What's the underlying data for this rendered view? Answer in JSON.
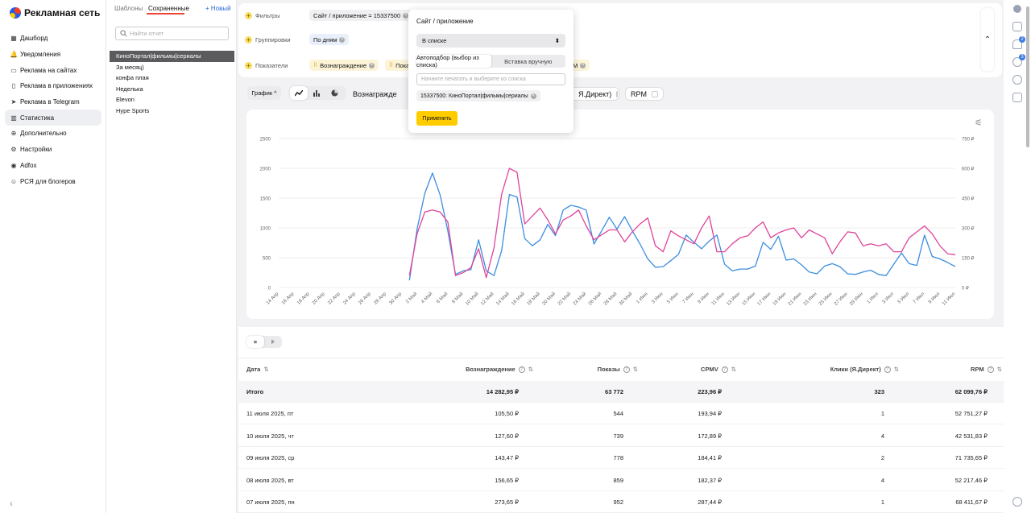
{
  "brand": {
    "name": "Рекламная сеть"
  },
  "nav": [
    {
      "label": "Дашборд",
      "icon": "dashboard-icon",
      "glyph": "▦"
    },
    {
      "label": "Уведомления",
      "icon": "bell-icon",
      "glyph": "🔔"
    },
    {
      "label": "Реклама на сайтах",
      "icon": "monitor-icon",
      "glyph": "▭"
    },
    {
      "label": "Реклама в приложениях",
      "icon": "phone-icon",
      "glyph": "▯"
    },
    {
      "label": "Реклама в Telegram",
      "icon": "telegram-icon",
      "glyph": "➤"
    },
    {
      "label": "Статистика",
      "icon": "chart-icon",
      "glyph": "▥",
      "active": true
    },
    {
      "label": "Дополнительно",
      "icon": "plus-circle-icon",
      "glyph": "⊕"
    },
    {
      "label": "Настройки",
      "icon": "wrench-icon",
      "glyph": "⚙"
    },
    {
      "label": "Adfox",
      "icon": "adfox-icon",
      "glyph": "◉"
    },
    {
      "label": "РСЯ для блогеров",
      "icon": "blogger-icon",
      "glyph": "☺"
    }
  ],
  "panel": {
    "tab_templates": "Шаблоны",
    "tab_saved": "Сохраненные",
    "new_label": "+ Новый",
    "search_placeholder": "Найти отчет",
    "reports": [
      "КиноПортал|фильмы|сериалы",
      "За месяц)",
      "конфа плая",
      "Неделька",
      "Elevon",
      "Hype Sports"
    ]
  },
  "filters": {
    "filters_label": "Фильтры",
    "filter_chip": "Сайт / приложение = 15337500",
    "groupings_label": "Группировки",
    "grouping_chip": "По дням",
    "indicators_label": "Показатели",
    "indicator_chips": [
      "Вознаграждение",
      "Пока",
      "М"
    ]
  },
  "toolbar": {
    "view_label": "График",
    "metrics": [
      "Вознагражде",
      "Я.Директ)",
      "RPM"
    ]
  },
  "popup": {
    "title": "Сайт / приложение",
    "select_value": "В списке",
    "tab_auto": "Автоподбор (выбор из списка)",
    "tab_manual": "Вставка вручную",
    "input_placeholder": "Начните печатать и выберите из списка",
    "selected_chip": "15337500: КиноПортал|фильмы|сериалы",
    "apply_label": "Применить"
  },
  "chart_data": {
    "type": "line",
    "x": [
      "14 Апр",
      "16 Апр",
      "18 Апр",
      "20 Апр",
      "22 Апр",
      "24 Апр",
      "26 Апр",
      "28 Апр",
      "30 Апр",
      "2 Май",
      "4 Май",
      "6 Май",
      "8 Май",
      "10 Май",
      "12 Май",
      "14 Май",
      "16 Май",
      "18 Май",
      "20 Май",
      "22 Май",
      "24 Май",
      "26 Май",
      "28 Май",
      "30 Май",
      "1 Июн",
      "3 Июн",
      "5 Июн",
      "7 Июн",
      "9 Июн",
      "11 Июн",
      "13 Июн",
      "15 Июн",
      "17 Июн",
      "19 Июн",
      "21 Июн",
      "23 Июн",
      "25 Июн",
      "27 Июн",
      "29 Июн",
      "1 Июл",
      "3 Июл",
      "5 Июл",
      "7 Июл",
      "9 Июл",
      "11 Июл"
    ],
    "left_axis": {
      "ticks": [
        "0",
        "500",
        "1000",
        "1500",
        "2000",
        "2500"
      ],
      "ylim": [
        0,
        2500
      ]
    },
    "right_axis": {
      "ticks": [
        "0 ₽",
        "150 ₽",
        "300 ₽",
        "450 ₽",
        "600 ₽",
        "750 ₽"
      ],
      "ylim": [
        0,
        750
      ]
    },
    "series": [
      {
        "color": "#3b8ee0",
        "axis": "left",
        "start_index": 17,
        "values": [
          120,
          980,
          1580,
          1920,
          1550,
          950,
          220,
          280,
          300,
          800,
          280,
          200,
          620,
          1560,
          1520,
          820,
          700,
          800,
          1060,
          870,
          1300,
          1380,
          1350,
          1300,
          730,
          950,
          1180,
          980,
          1190,
          950,
          730,
          480,
          340,
          350,
          450,
          560,
          880,
          760,
          650,
          780,
          880,
          390,
          280,
          310,
          310,
          360,
          760,
          640,
          860,
          460,
          480,
          380,
          260,
          230,
          360,
          400,
          350,
          230,
          220,
          260,
          290,
          220,
          200,
          390,
          580,
          400,
          370,
          880,
          520,
          480,
          420,
          350
        ]
      },
      {
        "color": "#e0439b",
        "axis": "right",
        "start_index": 17,
        "values": [
          60,
          270,
          380,
          390,
          380,
          330,
          60,
          75,
          100,
          195,
          50,
          200,
          470,
          600,
          580,
          320,
          360,
          400,
          340,
          270,
          340,
          360,
          390,
          310,
          240,
          265,
          290,
          290,
          230,
          280,
          320,
          350,
          210,
          180,
          285,
          260,
          240,
          220,
          300,
          360,
          180,
          180,
          220,
          250,
          260,
          300,
          330,
          250,
          275,
          290,
          300,
          250,
          290,
          270,
          250,
          170,
          230,
          280,
          275,
          210,
          220,
          210,
          220,
          180,
          180,
          250,
          280,
          310,
          270,
          210,
          170,
          165
        ]
      }
    ]
  },
  "table": {
    "headers": [
      "Дата",
      "Вознаграждение",
      "Показы",
      "CPMV",
      "Клики (Я.Директ)",
      "RPM"
    ],
    "total": [
      "Итого",
      "14 282,95 ₽",
      "63 772",
      "223,96 ₽",
      "323",
      "62 099,76 ₽"
    ],
    "rows": [
      [
        "11 июля 2025, пт",
        "105,50 ₽",
        "544",
        "193,94 ₽",
        "1",
        "52 751,27 ₽"
      ],
      [
        "10 июля 2025, чт",
        "127,60 ₽",
        "739",
        "172,89 ₽",
        "4",
        "42 531,83 ₽"
      ],
      [
        "09 июля 2025, ср",
        "143,47 ₽",
        "778",
        "184,41 ₽",
        "2",
        "71 735,65 ₽"
      ],
      [
        "08 июля 2025, вт",
        "156,65 ₽",
        "859",
        "182,37 ₽",
        "4",
        "52 217,46 ₽"
      ],
      [
        "07 июля 2025, пн",
        "273,65 ₽",
        "952",
        "287,44 ₽",
        "1",
        "68 411,67 ₽"
      ]
    ]
  }
}
